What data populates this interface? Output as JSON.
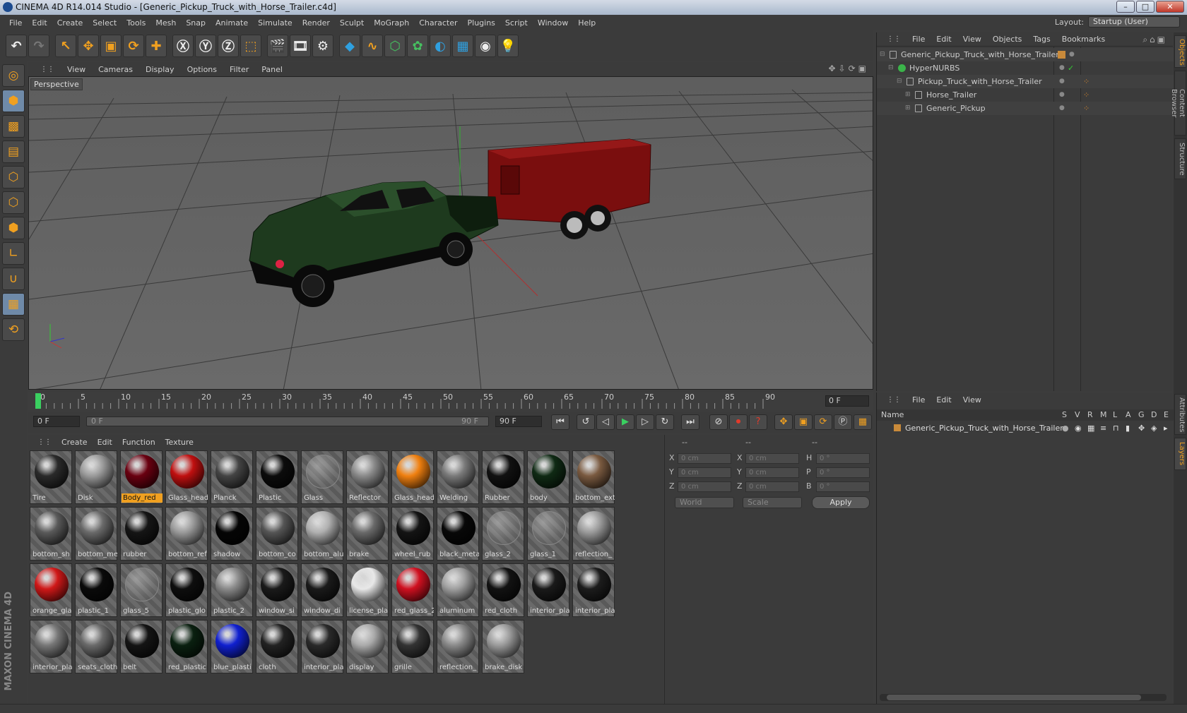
{
  "title": {
    "text": "CINEMA 4D R14.014 Studio - [Generic_Pickup_Truck_with_Horse_Trailer.c4d]"
  },
  "window_buttons": {
    "min": "–",
    "max": "□",
    "close": "✕"
  },
  "menubar": {
    "items": [
      "File",
      "Edit",
      "Create",
      "Select",
      "Tools",
      "Mesh",
      "Snap",
      "Animate",
      "Simulate",
      "Render",
      "Sculpt",
      "MoGraph",
      "Character",
      "Plugins",
      "Script",
      "Window",
      "Help"
    ]
  },
  "layout": {
    "label": "Layout:",
    "value": "Startup (User)"
  },
  "viewport": {
    "menu": [
      "View",
      "Cameras",
      "Display",
      "Options",
      "Filter",
      "Panel"
    ],
    "label": "Perspective",
    "colors": {
      "truck_body": "#1e3a1e",
      "trailer_body": "#7a0e0e"
    }
  },
  "timeline": {
    "ticks": [
      "0",
      "5",
      "10",
      "15",
      "20",
      "25",
      "30",
      "35",
      "40",
      "45",
      "50",
      "55",
      "60",
      "65",
      "70",
      "75",
      "80",
      "85",
      "90"
    ],
    "end_frame": "0 F"
  },
  "transport": {
    "current_frame": "0 F",
    "range_start": "0 F",
    "range_end": "90 F",
    "max_frame": "90 F"
  },
  "materials": {
    "menu": [
      "Create",
      "Edit",
      "Function",
      "Texture"
    ],
    "items": [
      {
        "name": "Tire",
        "color": "#2a2a2a"
      },
      {
        "name": "Disk",
        "color": "#9a9a9a"
      },
      {
        "name": "Body_red",
        "color": "#6a0010",
        "selected": true
      },
      {
        "name": "Glass_head",
        "color": "#c01010"
      },
      {
        "name": "Planck",
        "color": "#444444"
      },
      {
        "name": "Plastic",
        "color": "#0c0c0c"
      },
      {
        "name": "Glass",
        "color": "transparent"
      },
      {
        "name": "Reflector",
        "color": "#8a8a8a"
      },
      {
        "name": "Glass_head",
        "color": "#f08010"
      },
      {
        "name": "Welding",
        "color": "#7a7a7a"
      },
      {
        "name": "Rubber",
        "color": "#111111"
      },
      {
        "name": "body",
        "color": "#0f2a14"
      },
      {
        "name": "bottom_ext",
        "color": "#7a5a40"
      },
      {
        "name": "bottom_sh",
        "color": "#5a5a5a"
      },
      {
        "name": "bottom_me",
        "color": "#6a6a6a"
      },
      {
        "name": "rubber",
        "color": "#151515"
      },
      {
        "name": "bottom_ref",
        "color": "#9a9a9a"
      },
      {
        "name": "shadow",
        "color": "#050505"
      },
      {
        "name": "bottom_co",
        "color": "#555555"
      },
      {
        "name": "bottom_alu",
        "color": "#b0b0b0"
      },
      {
        "name": "brake",
        "color": "#6a6a6a"
      },
      {
        "name": "wheel_rub",
        "color": "#141414"
      },
      {
        "name": "black_meta",
        "color": "#080808"
      },
      {
        "name": "glass_2",
        "color": "transparent"
      },
      {
        "name": "glass_1",
        "color": "transparent"
      },
      {
        "name": "reflection_",
        "color": "#9a9a9a"
      },
      {
        "name": "orange_gla",
        "color": "#d01818"
      },
      {
        "name": "plastic_1",
        "color": "#0a0a0a"
      },
      {
        "name": "glass_5",
        "color": "transparent"
      },
      {
        "name": "plastic_glo",
        "color": "#0e0e0e"
      },
      {
        "name": "plastic_2",
        "color": "#8a8a8a"
      },
      {
        "name": "window_si",
        "color": "#1a1a1a"
      },
      {
        "name": "window_di",
        "color": "#1a1a1a"
      },
      {
        "name": "license_pla",
        "color": "#e8e8e8"
      },
      {
        "name": "red_glass_2",
        "color": "#d01020"
      },
      {
        "name": "aluminum",
        "color": "#a0a0a0"
      },
      {
        "name": "red_cloth",
        "color": "#121212"
      },
      {
        "name": "interior_pla",
        "color": "#1a1a1a"
      },
      {
        "name": "interior_pla",
        "color": "#1c1c1c"
      },
      {
        "name": "interior_pla",
        "color": "#777777"
      },
      {
        "name": "seats_cloth",
        "color": "#6a6a6a"
      },
      {
        "name": "belt",
        "color": "#141414"
      },
      {
        "name": "red_plastic",
        "color": "#0a2010"
      },
      {
        "name": "blue_plasti",
        "color": "#1020d0"
      },
      {
        "name": "cloth",
        "color": "#222222"
      },
      {
        "name": "interior_pla",
        "color": "#2a2a2a"
      },
      {
        "name": "display",
        "color": "#aaaaaa"
      },
      {
        "name": "grille",
        "color": "#333333"
      },
      {
        "name": "reflection_",
        "color": "#8a8a8a"
      },
      {
        "name": "brake_disk",
        "color": "#9a9a9a"
      }
    ]
  },
  "attributes": {
    "header": [
      "--",
      "--",
      "--"
    ],
    "rows": [
      {
        "a": "X",
        "av": "0 cm",
        "b": "X",
        "bv": "0 cm",
        "c": "H",
        "cv": "0 °"
      },
      {
        "a": "Y",
        "av": "0 cm",
        "b": "Y",
        "bv": "0 cm",
        "c": "P",
        "cv": "0 °"
      },
      {
        "a": "Z",
        "av": "0 cm",
        "b": "Z",
        "bv": "0 cm",
        "c": "B",
        "cv": "0 °"
      }
    ],
    "coord_system": "World",
    "mode": "Scale",
    "apply": "Apply"
  },
  "objects": {
    "menu": [
      "File",
      "Edit",
      "View",
      "Objects",
      "Tags",
      "Bookmarks"
    ],
    "tree": [
      {
        "name": "Generic_Pickup_Truck_with_Horse_Trailer",
        "indent": 0
      },
      {
        "name": "HyperNURBS",
        "indent": 1
      },
      {
        "name": "Pickup_Truck_with_Horse_Trailer",
        "indent": 2
      },
      {
        "name": "Horse_Trailer",
        "indent": 3
      },
      {
        "name": "Generic_Pickup",
        "indent": 3
      }
    ],
    "check": "✓"
  },
  "layers": {
    "menu": [
      "File",
      "Edit",
      "View"
    ],
    "columns": {
      "name": "Name",
      "flags": [
        "S",
        "V",
        "R",
        "M",
        "L",
        "A",
        "G",
        "D",
        "E"
      ]
    },
    "row": "Generic_Pickup_Truck_with_Horse_Trailer"
  },
  "sidetabs": [
    "Objects",
    "Content Browser",
    "Structure",
    "Attributes",
    "Layers"
  ],
  "branding": {
    "maxon": "MAXON",
    "cinema": "CINEMA 4D"
  }
}
